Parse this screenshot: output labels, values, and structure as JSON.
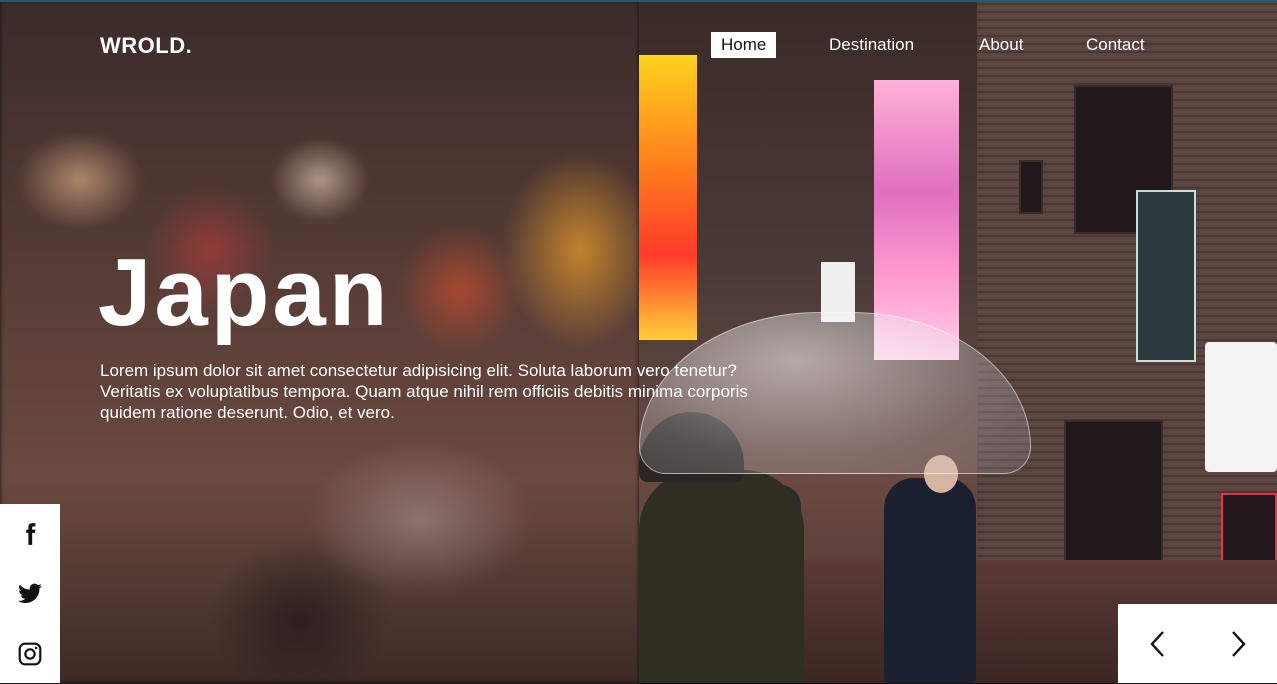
{
  "brand": {
    "logo": "WROLD."
  },
  "nav": {
    "items": [
      {
        "label": "Home",
        "active": true
      },
      {
        "label": "Destination",
        "active": false
      },
      {
        "label": "About",
        "active": false
      },
      {
        "label": "Contact",
        "active": false
      }
    ]
  },
  "hero": {
    "title": "Japan",
    "description": "Lorem ipsum dolor sit amet consectetur adipisicing elit. Soluta laborum vero tenetur? Veritatis ex voluptatibus tempora. Quam atque nihil rem officiis debitis minima corporis quidem ratione deserunt. Odio, et vero."
  },
  "social": {
    "items": [
      {
        "icon": "facebook-icon"
      },
      {
        "icon": "twitter-icon"
      },
      {
        "icon": "instagram-icon"
      }
    ]
  },
  "slider": {
    "prev_icon": "chevron-left-icon",
    "next_icon": "chevron-right-icon"
  },
  "colors": {
    "text": "#ffffff",
    "panel": "#ffffff",
    "nav_active_bg": "#ffffff",
    "nav_active_text": "#111111"
  }
}
